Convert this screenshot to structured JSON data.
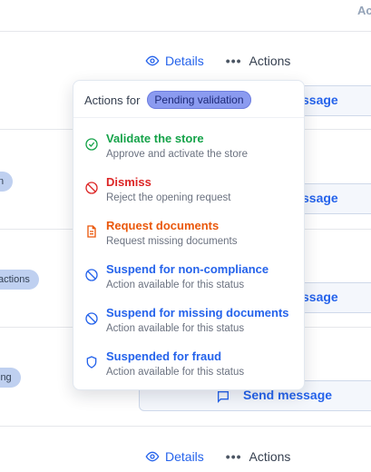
{
  "table": {
    "header_right": "Ac"
  },
  "rows": [
    {
      "details_label": "Details",
      "actions_label": "Actions"
    },
    {
      "status_pill": "n",
      "message_label": "ssage"
    },
    {
      "status_pill": "actions",
      "message_label": "ssage"
    },
    {
      "status_pill": "ing",
      "message_label": "Send message"
    },
    {
      "details_label": "Details",
      "actions_label": "Actions"
    }
  ],
  "first_message_label": "ssage",
  "menu": {
    "header_label": "Actions for",
    "status_badge": "Pending validation",
    "items": [
      {
        "title": "Validate the store",
        "subtitle": "Approve and activate the store",
        "icon": "check-circle-icon",
        "color": "#16a34a"
      },
      {
        "title": "Dismiss",
        "subtitle": "Reject the opening request",
        "icon": "ban-icon",
        "color": "#dc2626"
      },
      {
        "title": "Request documents",
        "subtitle": "Request missing documents",
        "icon": "document-icon",
        "color": "#ea580c"
      },
      {
        "title": "Suspend for non-compliance",
        "subtitle": "Action available for this status",
        "icon": "ban-icon",
        "color": "#2563eb"
      },
      {
        "title": "Suspend for missing documents",
        "subtitle": "Action available for this status",
        "icon": "ban-icon",
        "color": "#2563eb"
      },
      {
        "title": "Suspended for fraud",
        "subtitle": "Action available for this status",
        "icon": "shield-icon",
        "color": "#2563eb"
      }
    ]
  }
}
